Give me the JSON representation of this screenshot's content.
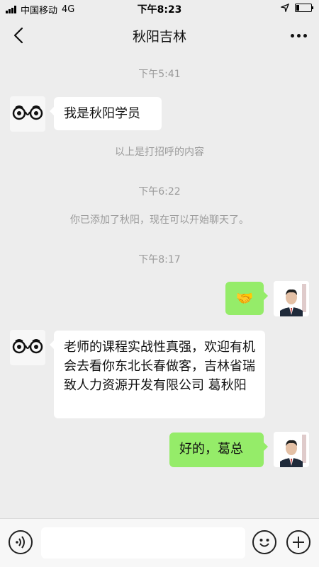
{
  "status_bar": {
    "carrier": "中国移动",
    "network": "4G",
    "time": "下午8:23",
    "battery_level": 0.2
  },
  "header": {
    "title": "秋阳吉林",
    "back_icon": "chevron-left-icon",
    "more_icon": "more-icon"
  },
  "messages": {
    "ts1": "下午5:41",
    "m1": "我是秋阳学员",
    "sys1": "以上是打招呼的内容",
    "ts2": "下午6:22",
    "sys2": "你已添加了秋阳，现在可以开始聊天了。",
    "ts3": "下午8:17",
    "m2_emoji": "🤝",
    "m3": "老师的课程实战性真强，欢迎有机会去看你东北长春做客，吉林省瑞致人力资源开发有限公司  葛秋阳",
    "m4": "好的，葛总"
  },
  "input_bar": {
    "placeholder": "",
    "voice_icon": "voice-icon",
    "emoji_icon": "emoji-icon",
    "plus_icon": "plus-icon"
  },
  "colors": {
    "background": "#ededed",
    "sent_bubble": "#95ec69",
    "received_bubble": "#ffffff",
    "timestamp": "#9a9a9a"
  }
}
